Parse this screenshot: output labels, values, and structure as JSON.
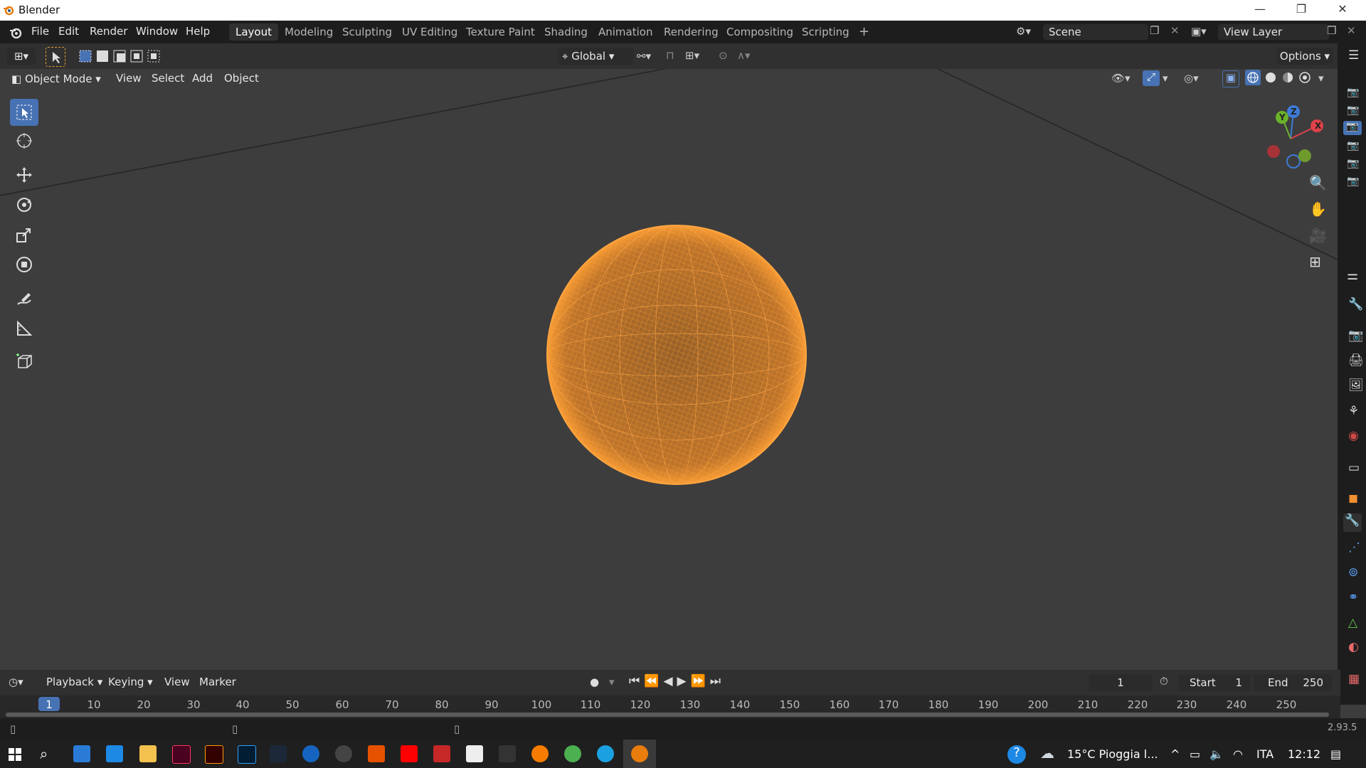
{
  "window": {
    "title": "Blender",
    "minimize": "—",
    "maximize": "❐",
    "close": "✕"
  },
  "menu": {
    "items": [
      "File",
      "Edit",
      "Render",
      "Window",
      "Help"
    ]
  },
  "workspaces": {
    "tabs": [
      "Layout",
      "Modeling",
      "Sculpting",
      "UV Editing",
      "Texture Paint",
      "Shading",
      "Animation",
      "Rendering",
      "Compositing",
      "Scripting"
    ],
    "active": "Layout",
    "add": "+"
  },
  "scene": {
    "name": "Scene",
    "view_layer": "View Layer"
  },
  "tool_settings": {
    "orientation": "Global",
    "options": "Options"
  },
  "viewport_header": {
    "mode": "Object Mode",
    "menus": [
      "View",
      "Select",
      "Add",
      "Object"
    ]
  },
  "gizmo": {
    "x": "X",
    "y": "Y",
    "z": "Z"
  },
  "timeline": {
    "menus": [
      "Playback",
      "Keying",
      "View",
      "Marker"
    ],
    "current_frame": "1",
    "start_label": "Start",
    "start": "1",
    "end_label": "End",
    "end": "250",
    "ruler": [
      "1",
      "10",
      "20",
      "30",
      "40",
      "50",
      "60",
      "70",
      "80",
      "90",
      "100",
      "110",
      "120",
      "130",
      "140",
      "150",
      "160",
      "170",
      "180",
      "190",
      "200",
      "210",
      "220",
      "230",
      "240",
      "250"
    ]
  },
  "status": {
    "version": "2.93.5"
  },
  "taskbar": {
    "weather": "15°C  Pioggia l...",
    "language": "ITA",
    "time": "12:12"
  },
  "colors": {
    "accent": "#4772b3",
    "sphere": "#f0962e",
    "bg": "#3d3d3d"
  }
}
